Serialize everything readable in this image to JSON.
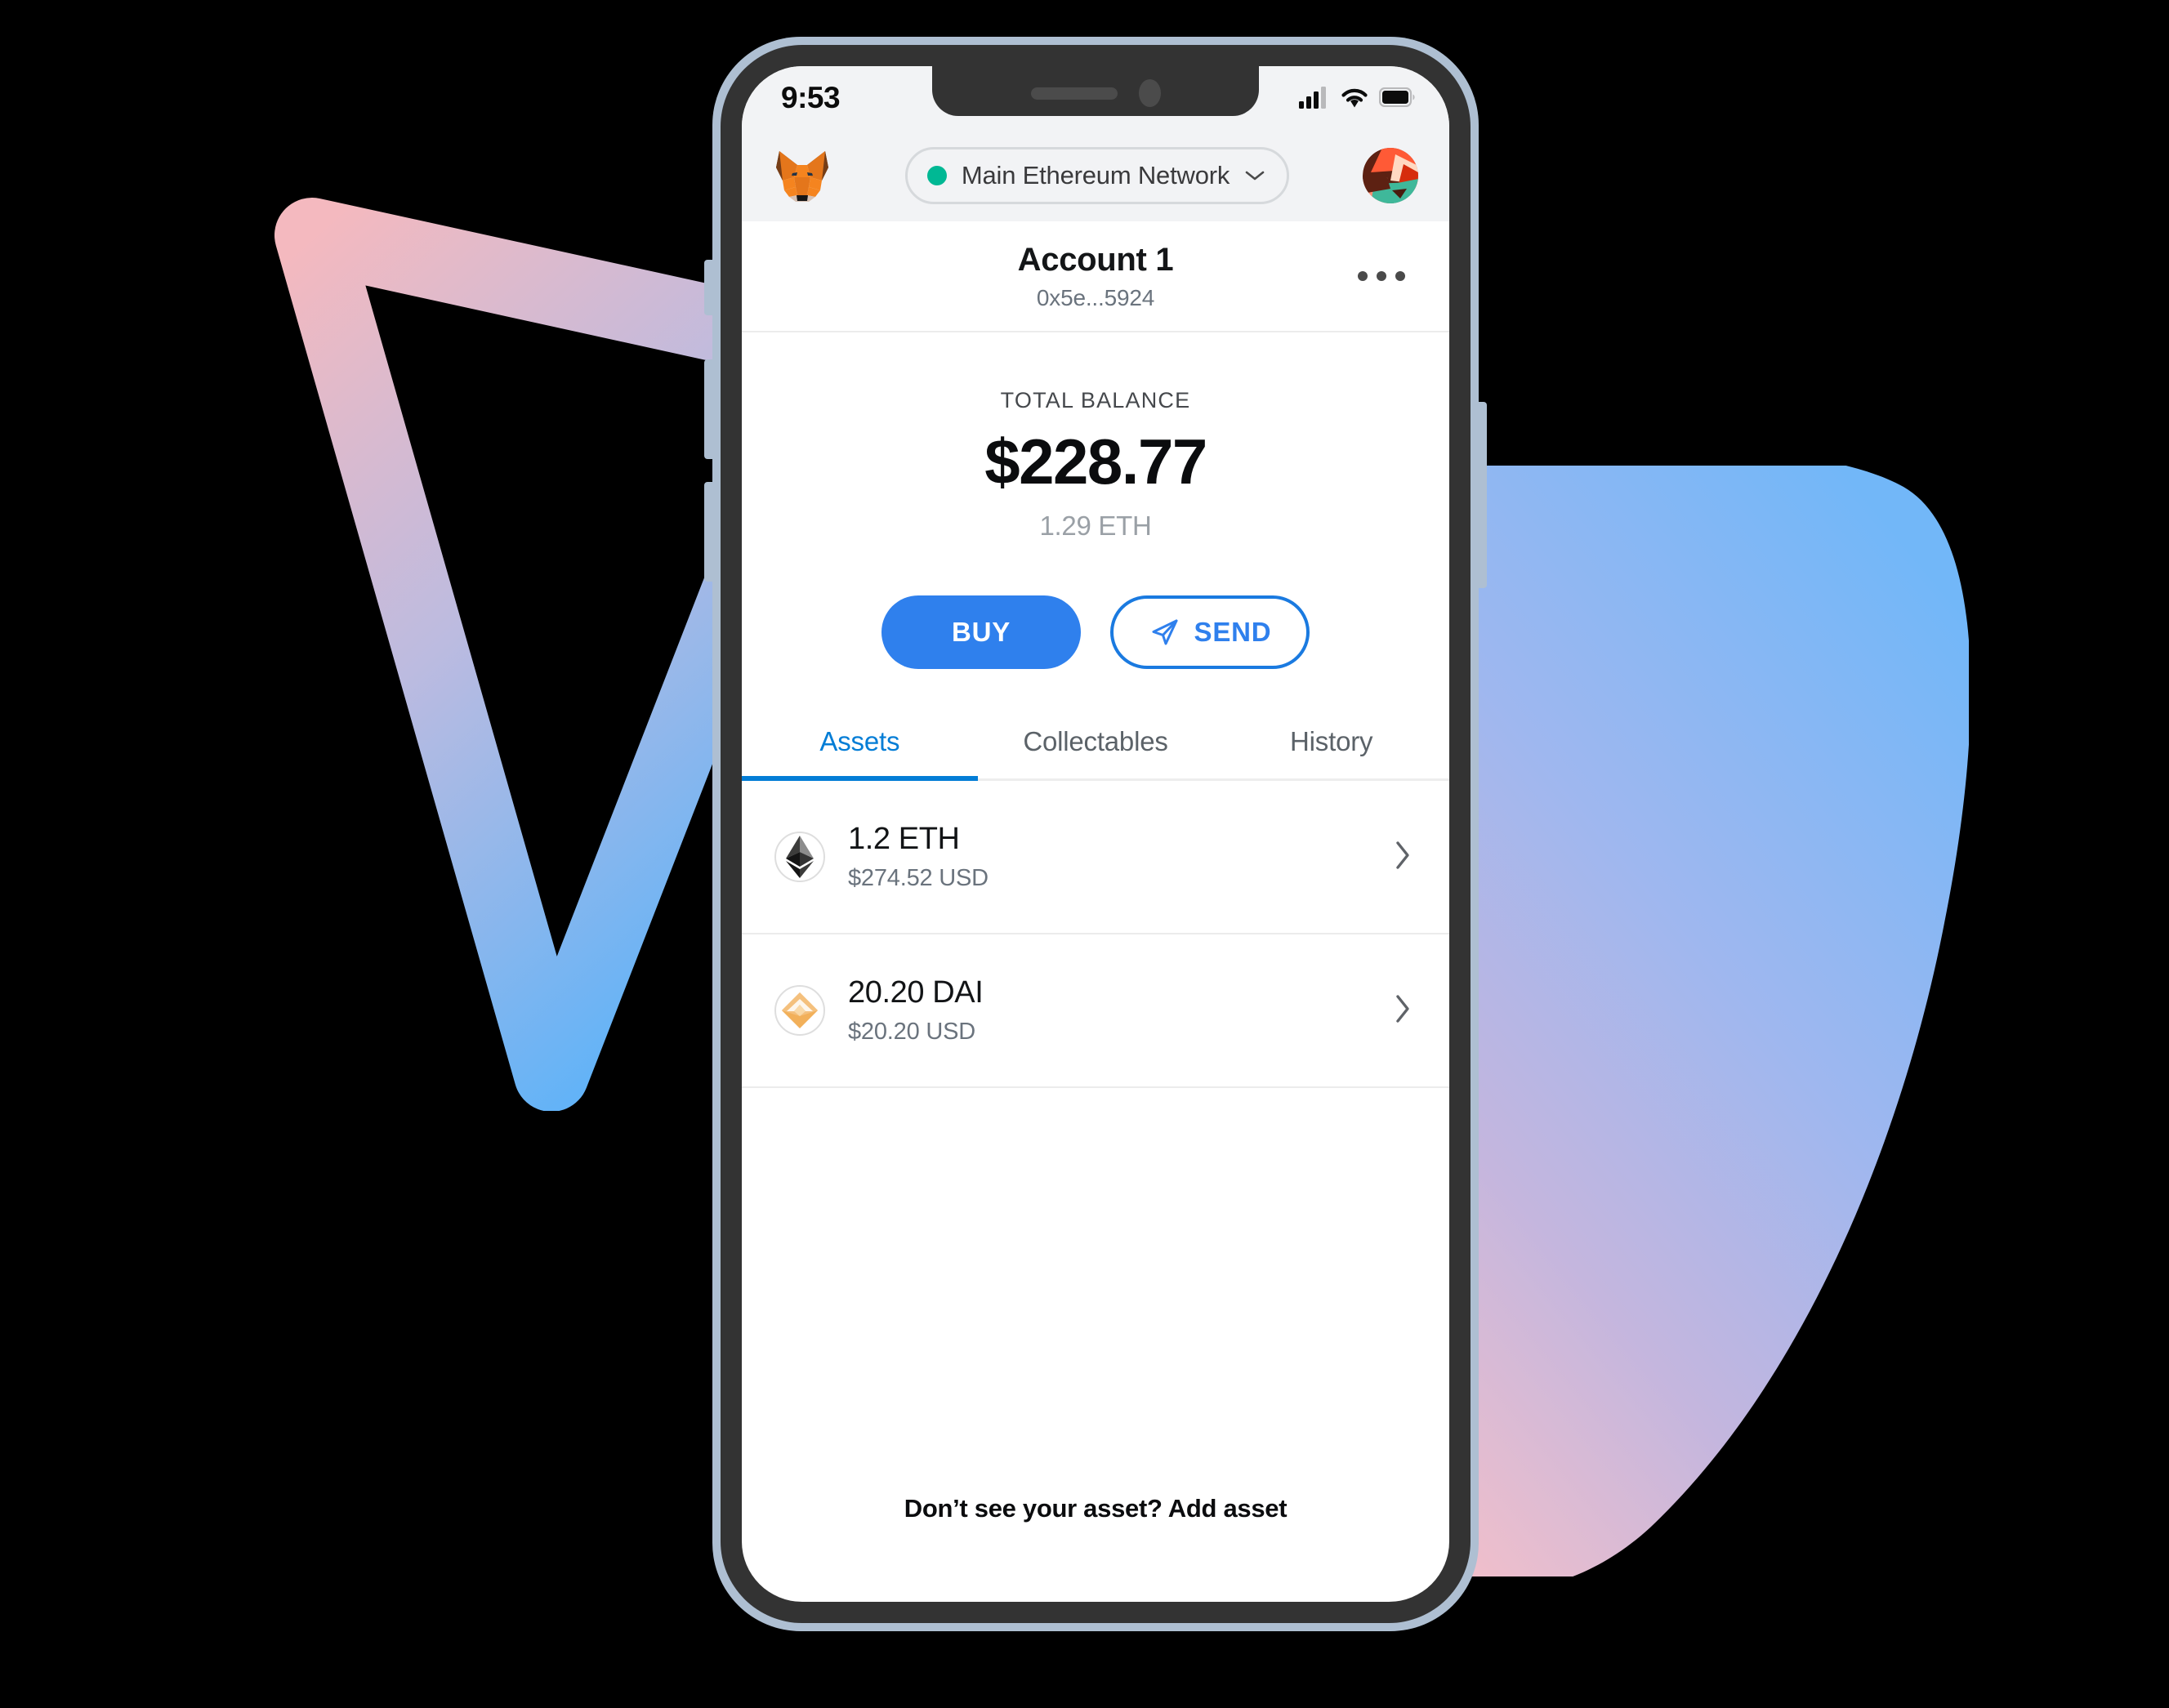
{
  "background": {
    "page_color": "#000000",
    "triangle_gradient_from": "#f4b9bf",
    "triangle_gradient_to": "#63b3f7",
    "blob_gradient_from": "#72b7f8",
    "blob_gradient_to": "#f0bfcb"
  },
  "device": {
    "frame_color": "#333333",
    "outline_color": "#aebfd2",
    "buttons": [
      {
        "name": "silence-switch"
      },
      {
        "name": "volume-up-button"
      },
      {
        "name": "volume-down-button"
      },
      {
        "name": "power-button"
      }
    ]
  },
  "status_bar": {
    "time": "9:53",
    "cellular_icon": "signal-bars-icon",
    "wifi_icon": "wifi-icon",
    "battery_icon": "battery-full-icon",
    "background": "#f2f3f5"
  },
  "app_header": {
    "logo_icon": "metamask-fox-logo",
    "network": {
      "label": "Main Ethereum Network",
      "dot_color": "#00b894",
      "chevron_icon": "chevron-down-icon"
    },
    "avatar_icon": "account-jazzicon-avatar"
  },
  "account": {
    "name": "Account 1",
    "address": "0x5e...5924",
    "menu_icon": "more-options-icon"
  },
  "balance": {
    "label": "TOTAL BALANCE",
    "fiat": "$228.77",
    "native": "1.29 ETH"
  },
  "actions": {
    "buy_label": "BUY",
    "send_label": "SEND",
    "send_icon": "paper-plane-icon",
    "primary_color": "#2f80ed",
    "outline_color": "#1a7ae0"
  },
  "tabs": [
    {
      "label": "Assets",
      "active": true
    },
    {
      "label": "Collectables",
      "active": false
    },
    {
      "label": "History",
      "active": false
    }
  ],
  "tab_accent_color": "#037dd6",
  "assets": [
    {
      "icon": "ethereum-token-icon",
      "amount": "1.2 ETH",
      "fiat": "$274.52 USD",
      "chevron_icon": "chevron-right-icon"
    },
    {
      "icon": "dai-token-icon",
      "amount": "20.20 DAI",
      "fiat": "$20.20 USD",
      "chevron_icon": "chevron-right-icon"
    }
  ],
  "footer": {
    "add_asset_text": "Don’t see your asset? Add asset"
  }
}
